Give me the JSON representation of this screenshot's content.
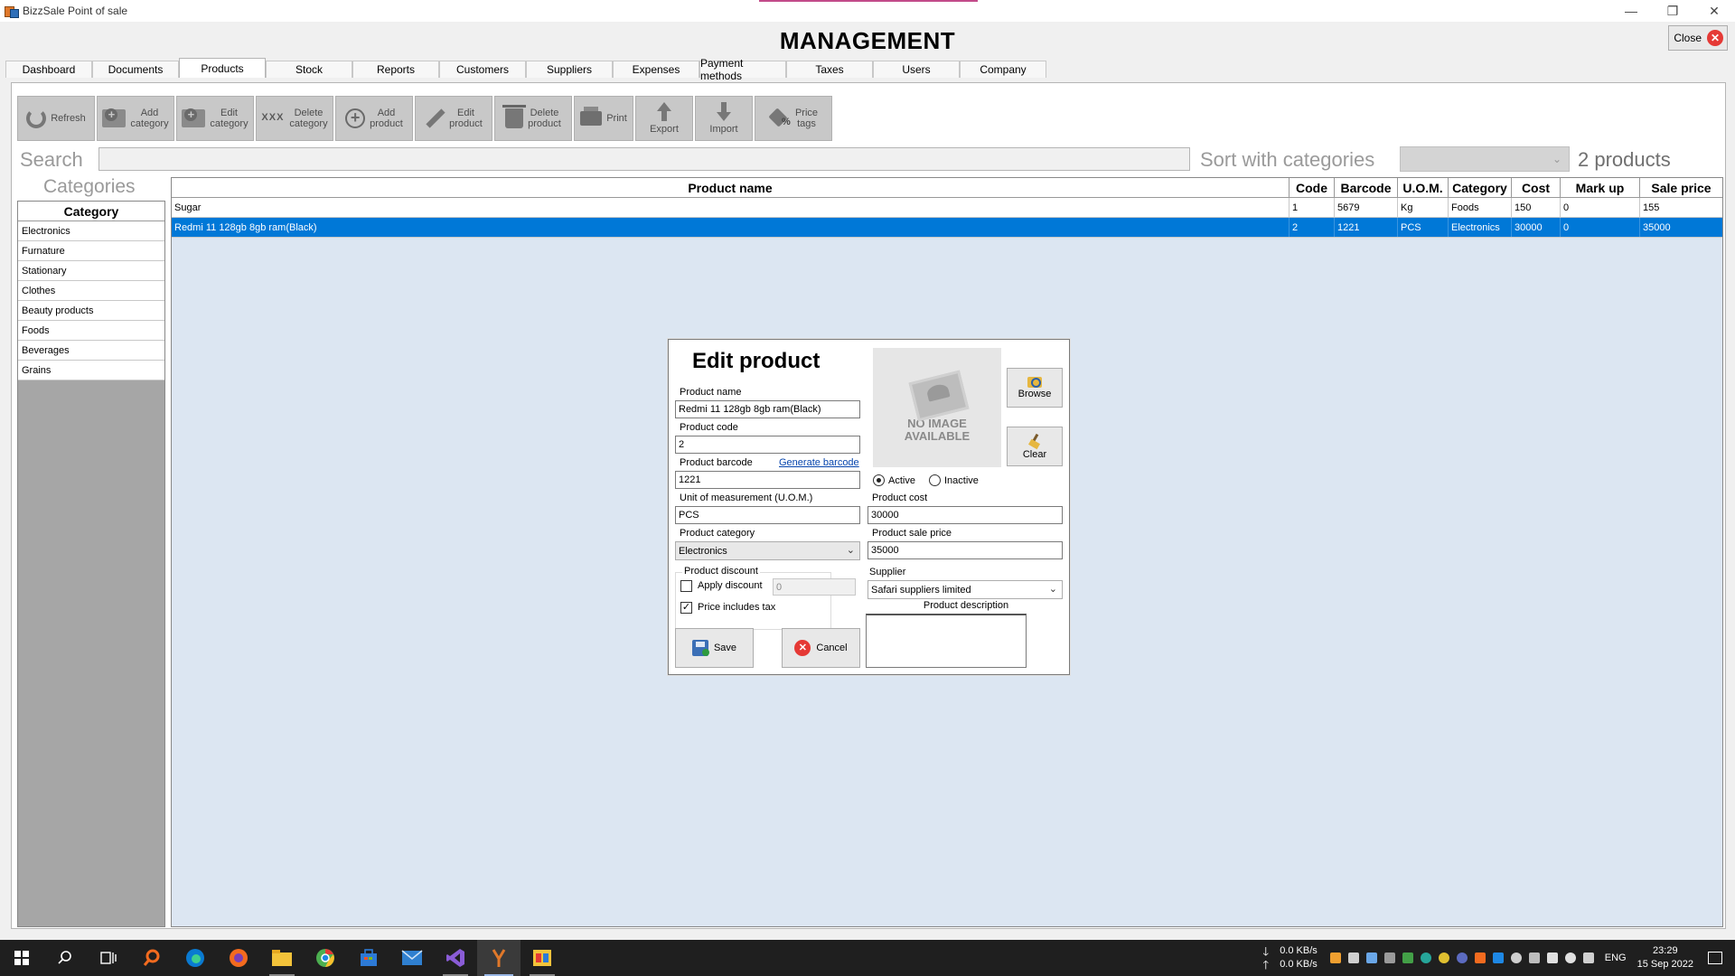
{
  "window": {
    "title": "BizzSale Point of sale",
    "minimize_glyph": "—",
    "restore_glyph": "❐",
    "close_glyph": "✕"
  },
  "header": {
    "title": "MANAGEMENT",
    "close_label": "Close",
    "close_glyph": "✕"
  },
  "tabs": [
    {
      "label": "Dashboard"
    },
    {
      "label": "Documents"
    },
    {
      "label": "Products"
    },
    {
      "label": "Stock"
    },
    {
      "label": "Reports"
    },
    {
      "label": "Customers"
    },
    {
      "label": "Suppliers"
    },
    {
      "label": "Expenses"
    },
    {
      "label": "Payment methods"
    },
    {
      "label": "Taxes"
    },
    {
      "label": "Users"
    },
    {
      "label": "Company"
    }
  ],
  "active_tab": "Products",
  "toolbar": {
    "refresh": "Refresh",
    "add_category": "Add\ncategory",
    "edit_category": "Edit\ncategory",
    "delete_category": "Delete\ncategory",
    "add_product": "Add\nproduct",
    "edit_product": "Edit\nproduct",
    "delete_product": "Delete\nproduct",
    "print": "Print",
    "export": "Export",
    "import": "Import",
    "price_tags": "Price\ntags",
    "delete_cat_icon_text": "XXX"
  },
  "search": {
    "label": "Search",
    "value": ""
  },
  "sort": {
    "label": "Sort with categories",
    "selected": "",
    "chevron": "⌄"
  },
  "product_count": "2 products",
  "categories": {
    "panel_label": "Categories",
    "header": "Category",
    "items": [
      "Electronics",
      "Furnature",
      "Stationary",
      "Clothes",
      "Beauty products",
      "Foods",
      "Beverages",
      "Grains"
    ]
  },
  "products": {
    "columns": [
      "Product name",
      "Code",
      "Barcode",
      "U.O.M.",
      "Category",
      "Cost",
      "Mark up",
      "Sale price"
    ],
    "rows": [
      {
        "name": "Sugar",
        "code": "1",
        "barcode": "5679",
        "uom": "Kg",
        "category": "Foods",
        "cost": "150",
        "markup": "0",
        "sale": "155"
      },
      {
        "name": "Redmi 11 128gb 8gb ram(Black)",
        "code": "2",
        "barcode": "1221",
        "uom": "PCS",
        "category": "Electronics",
        "cost": "30000",
        "markup": "0",
        "sale": "35000"
      }
    ],
    "selected_row": 1
  },
  "dialog": {
    "title": "Edit product",
    "product_name_label": "Product name",
    "product_name": "Redmi 11 128gb 8gb ram(Black)",
    "product_code_label": "Product code",
    "product_code": "2",
    "product_barcode_label": "Product barcode",
    "generate_barcode": "Generate barcode",
    "product_barcode": "1221",
    "uom_label": "Unit of measurement (U.O.M.)",
    "uom": "PCS",
    "category_label": "Product category",
    "category": "Electronics",
    "discount_group_label": "Product discount",
    "apply_discount_label": "Apply discount",
    "apply_discount_checked": false,
    "discount_value": "0",
    "price_includes_tax_label": "Price includes tax",
    "price_includes_tax_checked": true,
    "check_glyph": "✓",
    "no_image_text": "NO IMAGE\nAVAILABLE",
    "browse_label": "Browse",
    "clear_label": "Clear",
    "active_label": "Active",
    "inactive_label": "Inactive",
    "status": "Active",
    "cost_label": "Product cost",
    "cost": "30000",
    "sale_price_label": "Product sale price",
    "sale_price": "35000",
    "supplier_label": "Supplier",
    "supplier": "Safari suppliers limited",
    "description_label": "Product description",
    "description": "",
    "save_label": "Save",
    "cancel_label": "Cancel",
    "chevron": "⌄",
    "cancel_glyph": "✕"
  },
  "taskbar": {
    "net_down": "0.0 KB/s",
    "net_up": "0.0 KB/s",
    "down_arrow": "🡓",
    "up_arrow": "🡑",
    "language": "ENG",
    "time": "23:29",
    "date": "15 Sep 2022",
    "colors": {
      "edge": "#0a7ad1",
      "firefox": "#f36b1f",
      "explorer": "#f3c33a",
      "chrome": "#4caf50",
      "store": "#2d7ad6",
      "mail": "#2f80d0",
      "vs": "#8a5cd6",
      "active_app": "#e0782a",
      "tray_orange": "#f0a030"
    }
  }
}
